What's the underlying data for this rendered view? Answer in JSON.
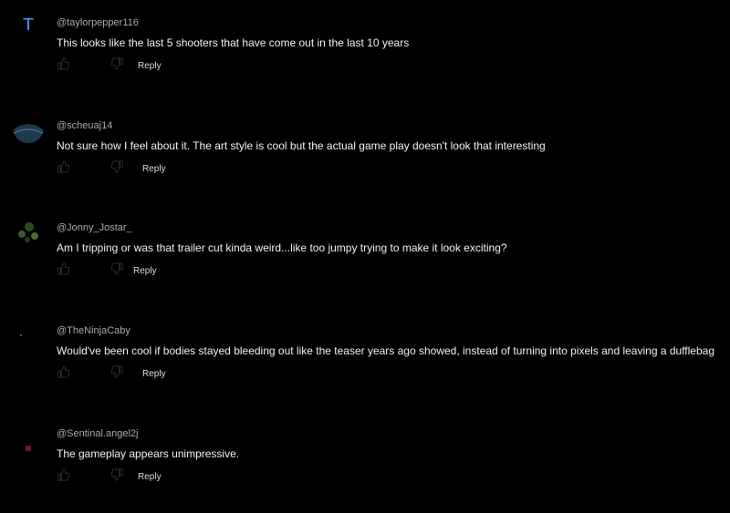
{
  "comments": [
    {
      "author": "@taylorpepper116",
      "avatar_letter": "T",
      "avatar_color": "#3ea6ff",
      "text": "This looks like the last 5 shooters that have come out in the last 10 years",
      "reply_label": "Reply"
    },
    {
      "author": "@scheuaj14",
      "text": "Not sure how I feel about it. The art style is cool but the actual game play doesn't look that interesting",
      "reply_label": "Reply"
    },
    {
      "author": "@Jonny_Jostar_",
      "text": "Am I tripping or was that trailer cut kinda weird...like too jumpy trying to make it look exciting?",
      "reply_label": "Reply"
    },
    {
      "author": "@TheNinjaCaby",
      "text": "Would've been cool if bodies stayed bleeding out like the teaser years ago showed, instead of turning into pixels and leaving a dufflebag",
      "reply_label": "Reply"
    },
    {
      "author": "@Sentinal.angel2j",
      "text": "The gameplay appears unimpressive.",
      "reply_label": "Reply"
    }
  ],
  "icons": {
    "like": "thumb-up-icon",
    "dislike": "thumb-down-icon"
  },
  "colors": {
    "background": "#000000",
    "text": "#f1f1f1",
    "author": "#aaaaaa",
    "avatar_accent": "#3ea6ff"
  }
}
